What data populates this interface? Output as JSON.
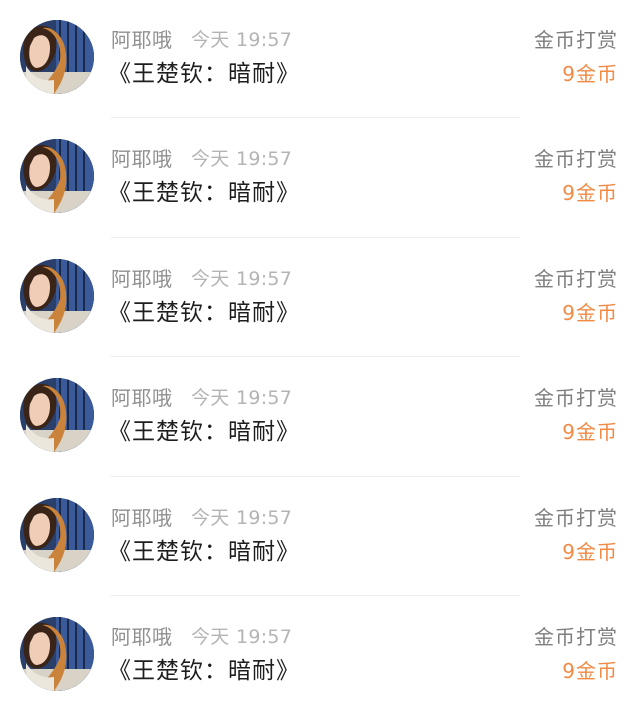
{
  "colors": {
    "name": "#8f8f8f",
    "time": "#b4b4b4",
    "content": "#1e1e1e",
    "type": "#7e7e7e",
    "amount": "#f08a45"
  },
  "rows": [
    {
      "name": "阿耶哦",
      "time": "今天 19:57",
      "content": "《王楚钦：暗耐》",
      "type": "金币打赏",
      "amount": "9金币",
      "avatar_icon": "user-avatar"
    },
    {
      "name": "阿耶哦",
      "time": "今天 19:57",
      "content": "《王楚钦：暗耐》",
      "type": "金币打赏",
      "amount": "9金币",
      "avatar_icon": "user-avatar"
    },
    {
      "name": "阿耶哦",
      "time": "今天 19:57",
      "content": "《王楚钦：暗耐》",
      "type": "金币打赏",
      "amount": "9金币",
      "avatar_icon": "user-avatar"
    },
    {
      "name": "阿耶哦",
      "time": "今天 19:57",
      "content": "《王楚钦：暗耐》",
      "type": "金币打赏",
      "amount": "9金币",
      "avatar_icon": "user-avatar"
    },
    {
      "name": "阿耶哦",
      "time": "今天 19:57",
      "content": "《王楚钦：暗耐》",
      "type": "金币打赏",
      "amount": "9金币",
      "avatar_icon": "user-avatar"
    },
    {
      "name": "阿耶哦",
      "time": "今天 19:57",
      "content": "《王楚钦：暗耐》",
      "type": "金币打赏",
      "amount": "9金币",
      "avatar_icon": "user-avatar"
    }
  ]
}
